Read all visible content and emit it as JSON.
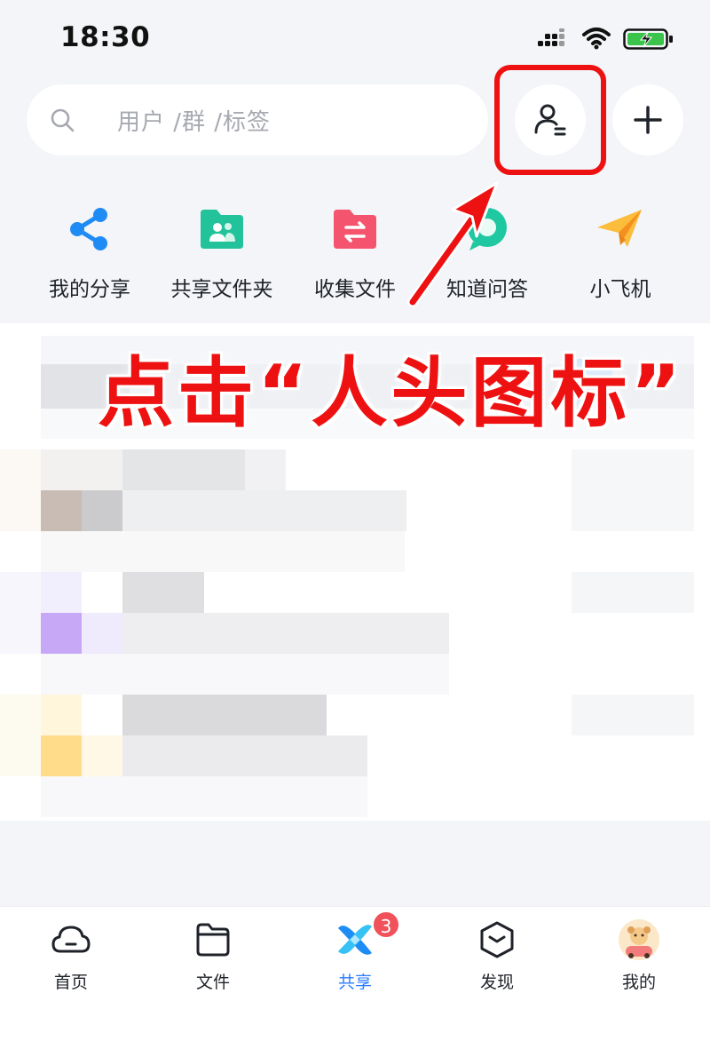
{
  "status_bar": {
    "time": "18:30"
  },
  "search": {
    "placeholder": "用户 /群 /标签"
  },
  "quick_actions": [
    {
      "label": "我的分享",
      "icon": "share-icon",
      "color": "#1f8cf5"
    },
    {
      "label": "共享文件夹",
      "icon": "shared-folder-icon",
      "color": "#22c39a"
    },
    {
      "label": "收集文件",
      "icon": "collect-folder-icon",
      "color": "#f5546f"
    },
    {
      "label": "知道问答",
      "icon": "qa-chat-icon",
      "color": "#1fc8a0"
    },
    {
      "label": "小飞机",
      "icon": "paper-plane-icon",
      "color": "#f8a825"
    }
  ],
  "annotation": {
    "text": "点击“人头图标”",
    "color": "#ee1111"
  },
  "tab_bar": {
    "tabs": [
      {
        "label": "首页",
        "icon": "cloud-home-icon",
        "active": false
      },
      {
        "label": "文件",
        "icon": "folder-icon",
        "active": false
      },
      {
        "label": "共享",
        "icon": "share-logo-icon",
        "active": true
      },
      {
        "label": "发现",
        "icon": "discover-box-icon",
        "active": false
      },
      {
        "label": "我的",
        "icon": "avatar",
        "active": false
      }
    ],
    "share_badge": "3",
    "active_color": "#2b7cff"
  }
}
